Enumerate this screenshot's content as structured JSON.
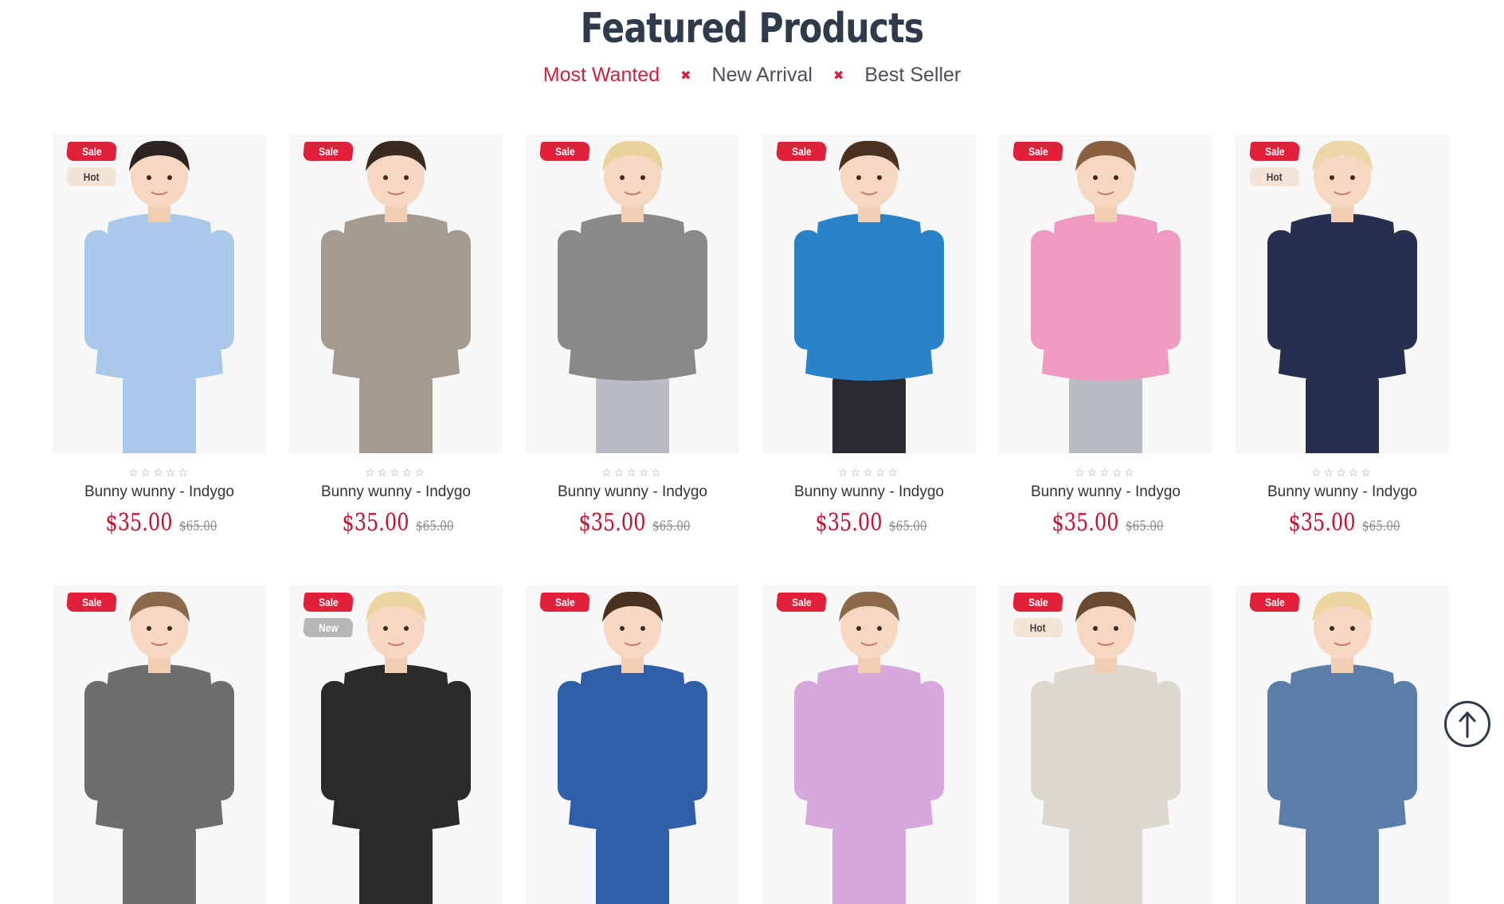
{
  "section": {
    "title": "Featured Products",
    "tabs": [
      {
        "label": "Most Wanted",
        "active": true
      },
      {
        "label": "New Arrival",
        "active": false
      },
      {
        "label": "Best Seller",
        "active": false
      }
    ],
    "separator_icon": "x-icon"
  },
  "products": [
    {
      "name": "Bunny wunny - Indygo",
      "price": "$35.00",
      "old_price": "$65.00",
      "badges": [
        "Sale",
        "Hot"
      ],
      "rating": "☆☆☆☆☆",
      "shirt": "#a9c8ea",
      "pants": "#a9c8ea",
      "hair": "#2b2420"
    },
    {
      "name": "Bunny wunny - Indygo",
      "price": "$35.00",
      "old_price": "$65.00",
      "badges": [
        "Sale"
      ],
      "rating": "☆☆☆☆☆",
      "shirt": "#a49a90",
      "pants": "#a49a90",
      "hair": "#3b2a1f"
    },
    {
      "name": "Bunny wunny - Indygo",
      "price": "$35.00",
      "old_price": "$65.00",
      "badges": [
        "Sale"
      ],
      "rating": "☆☆☆☆☆",
      "shirt": "#8a8888",
      "pants": "#b9bcc2",
      "hair": "#e9d29c"
    },
    {
      "name": "Bunny wunny - Indygo",
      "price": "$35.00",
      "old_price": "$65.00",
      "badges": [
        "Sale"
      ],
      "rating": "☆☆☆☆☆",
      "shirt": "#2a82c9",
      "pants": "#2a2a2e",
      "hair": "#4a3220"
    },
    {
      "name": "Bunny wunny - Indygo",
      "price": "$35.00",
      "old_price": "$65.00",
      "badges": [
        "Sale"
      ],
      "rating": "☆☆☆☆☆",
      "shirt": "#ef9ac0",
      "pants": "#b9bcc2",
      "hair": "#8a6040"
    },
    {
      "name": "Bunny wunny - Indygo",
      "price": "$35.00",
      "old_price": "$65.00",
      "badges": [
        "Sale",
        "Hot"
      ],
      "rating": "☆☆☆☆☆",
      "shirt": "#26304e",
      "pants": "#26304e",
      "hair": "#ead7a5"
    },
    {
      "badges": [
        "Sale"
      ],
      "shirt": "#6e6e70",
      "pants": "#6e6e70",
      "hair": "#8a6a4a"
    },
    {
      "badges": [
        "Sale",
        "New"
      ],
      "shirt": "#2a2a2a",
      "pants": "#2a2a2a",
      "hair": "#ecd59e"
    },
    {
      "badges": [
        "Sale"
      ],
      "shirt": "#2f5fa8",
      "pants": "#2f5fa8",
      "hair": "#4a3220"
    },
    {
      "badges": [
        "Sale"
      ],
      "shirt": "#d7a8dc",
      "pants": "#d7a8dc",
      "hair": "#8a6a4a"
    },
    {
      "badges": [
        "Sale",
        "Hot"
      ],
      "shirt": "#ddd8cf",
      "pants": "#ddd8cf",
      "hair": "#6a4a30"
    },
    {
      "badges": [
        "Sale"
      ],
      "shirt": "#5a7ea8",
      "pants": "#5a7ea8",
      "hair": "#ecd59e"
    }
  ],
  "back_to_top": {
    "icon": "arrow-up-icon"
  }
}
